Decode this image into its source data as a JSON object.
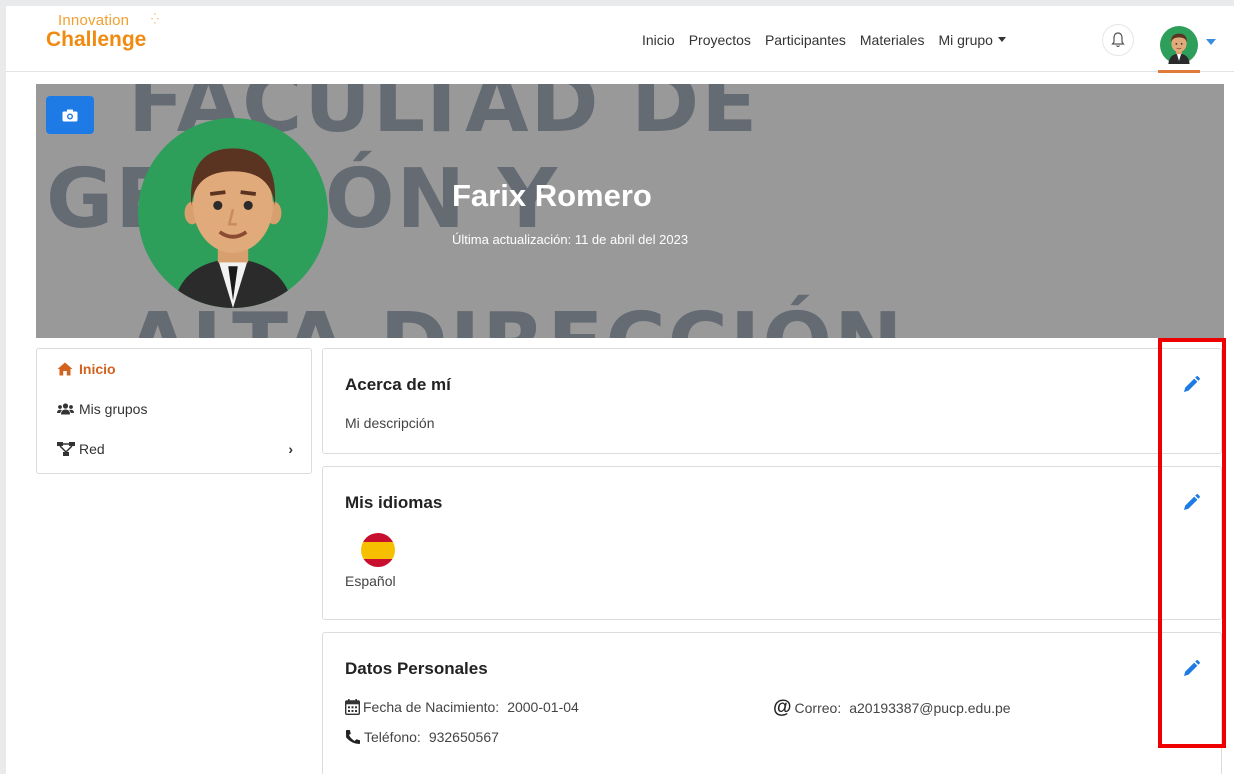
{
  "logo": {
    "top": "Innovation",
    "bottom": "Challenge"
  },
  "nav": {
    "links": [
      "Inicio",
      "Proyectos",
      "Participantes",
      "Materiales"
    ],
    "group_dropdown": "Mi grupo"
  },
  "banner": {
    "bg_lines": [
      "FACULTAD DE",
      "GESTIÓN Y",
      "ALTA DIRECCIÓN"
    ]
  },
  "profile": {
    "name": "Farix Romero",
    "updated": "Última actualización: 11 de abril del 2023"
  },
  "sidebar": {
    "items": [
      {
        "label": "Inicio",
        "icon": "home-icon",
        "active": true
      },
      {
        "label": "Mis grupos",
        "icon": "users-icon",
        "active": false
      },
      {
        "label": "Red",
        "icon": "network-icon",
        "active": false
      }
    ]
  },
  "about": {
    "title": "Acerca de mí",
    "text": "Mi descripción"
  },
  "languages": {
    "title": "Mis idiomas",
    "items": [
      {
        "label": "Español",
        "flag": "spain-flag"
      }
    ]
  },
  "personal": {
    "title": "Datos Personales",
    "birth_label": "Fecha de Nacimiento:",
    "birth_value": "2000-01-04",
    "email_label": "Correo:",
    "email_value": "a20193387@pucp.edu.pe",
    "phone_label": "Teléfono:",
    "phone_value": "932650567"
  },
  "colors": {
    "accent": "#d4621f",
    "primary": "#1e7be6",
    "highlight": "#ee0000"
  }
}
